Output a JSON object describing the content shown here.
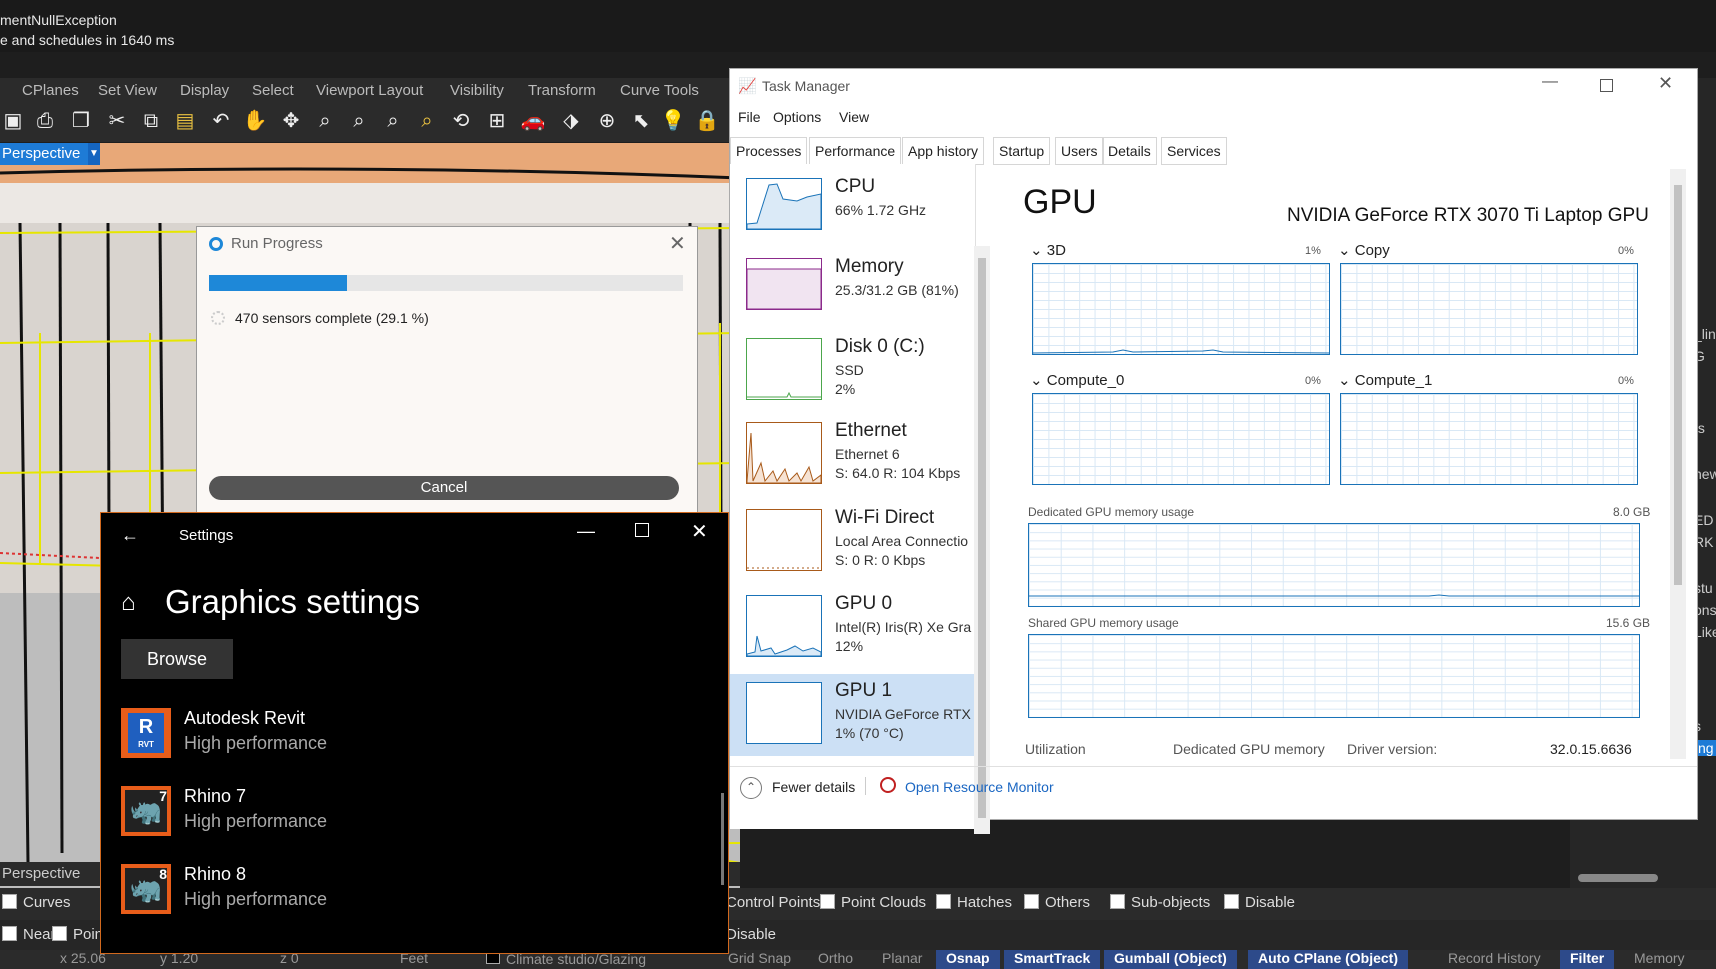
{
  "command_area": {
    "line1": "mentNullException",
    "line2": "e and schedules in 1640 ms"
  },
  "rhino_menu": [
    "CPlanes",
    "Set View",
    "Display",
    "Select",
    "Viewport Layout",
    "Visibility",
    "Transform",
    "Curve Tools"
  ],
  "viewport": {
    "name": "Perspective",
    "bottom_tab": "Perspective"
  },
  "right_panel": [
    "_lin",
    "G",
    "ts",
    "new",
    "ED",
    "RK",
    "stu",
    "ons",
    "Like",
    "s",
    "ng"
  ],
  "filter_row1": {
    "items": [
      "Curves",
      "Control Points",
      "Point Clouds",
      "Hatches",
      "Others",
      "Sub-objects",
      "Disable"
    ]
  },
  "filter_row2": {
    "items": [
      "Near",
      "Poin",
      "Disable"
    ]
  },
  "status_bar": {
    "coords": [
      "x 25.06",
      "y 1.20",
      "z 0"
    ],
    "unit": "Feet",
    "layer": "Climate studio/Glazing",
    "toggles": [
      "Grid Snap",
      "Ortho",
      "Planar",
      "Osnap",
      "SmartTrack",
      "Gumball (Object)",
      "Auto CPlane (Object)",
      "Record History",
      "Filter",
      "Memory"
    ]
  },
  "run_progress": {
    "title": "Run Progress",
    "progress": 0.291,
    "status": "470 sensors complete (29.1 %)",
    "cancel": "Cancel"
  },
  "settings": {
    "title": "Settings",
    "heading": "Graphics settings",
    "browse": "Browse",
    "apps": [
      {
        "name": "Autodesk Revit",
        "perf": "High performance",
        "icon": "R",
        "sub": "RVT"
      },
      {
        "name": "Rhino 7",
        "perf": "High performance",
        "icon": "7",
        "sub": ""
      },
      {
        "name": "Rhino 8",
        "perf": "High performance",
        "icon": "8",
        "sub": ""
      }
    ]
  },
  "task_manager": {
    "title": "Task Manager",
    "menu": [
      "File",
      "Options",
      "View"
    ],
    "tabs": [
      "Processes",
      "Performance",
      "App history",
      "Startup",
      "Users",
      "Details",
      "Services"
    ],
    "devices": [
      {
        "name": "CPU",
        "line1": "66%  1.72 GHz",
        "line2": "",
        "line3": ""
      },
      {
        "name": "Memory",
        "line1": "25.3/31.2 GB (81%)",
        "line2": "",
        "line3": ""
      },
      {
        "name": "Disk 0 (C:)",
        "line1": "SSD",
        "line2": "2%",
        "line3": ""
      },
      {
        "name": "Ethernet",
        "line1": "Ethernet 6",
        "line2": "S: 64.0  R: 104 Kbps",
        "line3": ""
      },
      {
        "name": "Wi-Fi Direct",
        "line1": "Local Area Connectio",
        "line2": "S: 0  R: 0 Kbps",
        "line3": ""
      },
      {
        "name": "GPU 0",
        "line1": "Intel(R) Iris(R) Xe Gra",
        "line2": "12%",
        "line3": ""
      },
      {
        "name": "GPU 1",
        "line1": "NVIDIA GeForce RTX",
        "line2": "1%  (70 °C)",
        "line3": ""
      }
    ],
    "gpu": {
      "title": "GPU",
      "model": "NVIDIA GeForce RTX 3070 Ti Laptop GPU",
      "engines": [
        {
          "name": "3D",
          "pct": "1%"
        },
        {
          "name": "Copy",
          "pct": "0%"
        },
        {
          "name": "Compute_0",
          "pct": "0%"
        },
        {
          "name": "Compute_1",
          "pct": "0%"
        }
      ],
      "dedicated_label": "Dedicated GPU memory usage",
      "dedicated_max": "8.0 GB",
      "shared_label": "Shared GPU memory usage",
      "shared_max": "15.6 GB",
      "footer": {
        "utilization": "Utilization",
        "dedicated": "Dedicated GPU memory",
        "driver_label": "Driver version:",
        "driver_value": "32.0.15.6636"
      }
    },
    "fewer_details": "Fewer details",
    "open_resource_monitor": "Open Resource Monitor"
  }
}
